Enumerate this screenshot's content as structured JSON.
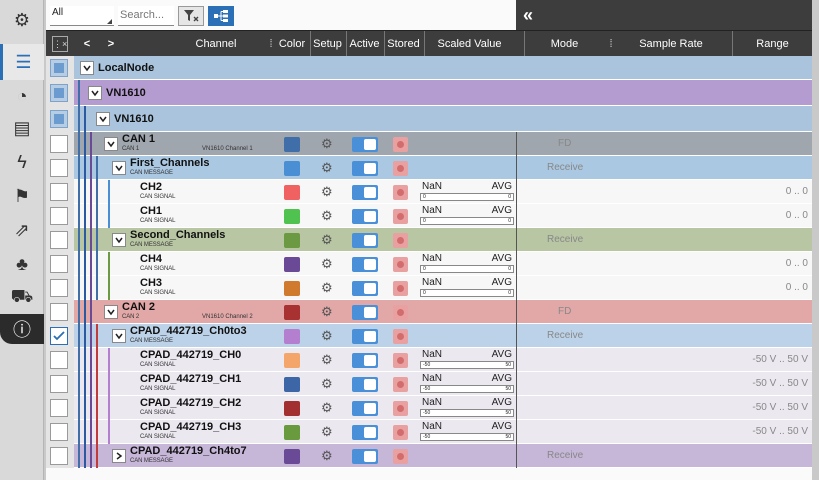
{
  "sidebar": {
    "items": [
      {
        "name": "settings-gear-icon",
        "glyph": "⚙"
      },
      {
        "name": "list-icon",
        "glyph": "☰"
      },
      {
        "name": "gauge-icon",
        "glyph": "◔"
      },
      {
        "name": "report-icon",
        "glyph": "▤"
      },
      {
        "name": "trigger-icon",
        "glyph": "ϟ"
      },
      {
        "name": "flag-icon",
        "glyph": "⚑"
      },
      {
        "name": "export-icon",
        "glyph": "⇗"
      },
      {
        "name": "network-icon",
        "glyph": "♣"
      },
      {
        "name": "vehicle-icon",
        "glyph": "⛟"
      },
      {
        "name": "info-icon",
        "glyph": "ⓘ"
      }
    ]
  },
  "toolbar": {
    "filter_value": "All",
    "search_placeholder": "Search...",
    "collapse_glyph": "«"
  },
  "header": {
    "nav_prev": "<",
    "nav_next": ">",
    "channel": "Channel",
    "color": "Color",
    "setup": "Setup",
    "active": "Active",
    "stored": "Stored",
    "scaled_value": "Scaled Value",
    "mode": "Mode",
    "sample_rate": "Sample Rate",
    "range": "Range"
  },
  "rows": [
    {
      "name": "LocalNode"
    },
    {
      "name": "VN1610"
    },
    {
      "name": "VN1610"
    },
    {
      "name": "CAN 1",
      "sub": "CAN 1",
      "sub2": "VN1610 Channel 1",
      "color": "#3f6ea8",
      "mode": "FD"
    },
    {
      "name": "First_Channels",
      "sub": "CAN MESSAGE",
      "color": "#4a8fd4",
      "mode": "Receive"
    },
    {
      "name": "CH2",
      "sub": "CAN SIGNAL",
      "color": "#f06262",
      "value": "NaN",
      "agg": "AVG",
      "bar_min": "0",
      "bar_max": "0",
      "range": "0 .. 0"
    },
    {
      "name": "CH1",
      "sub": "CAN SIGNAL",
      "color": "#4fc24f",
      "value": "NaN",
      "agg": "AVG",
      "bar_min": "0",
      "bar_max": "0",
      "range": "0 .. 0"
    },
    {
      "name": "Second_Channels",
      "sub": "CAN MESSAGE",
      "color": "#6b9a42",
      "mode": "Receive"
    },
    {
      "name": "CH4",
      "sub": "CAN SIGNAL",
      "color": "#6a4a96",
      "value": "NaN",
      "agg": "AVG",
      "bar_min": "0",
      "bar_max": "0",
      "range": "0 .. 0"
    },
    {
      "name": "CH3",
      "sub": "CAN SIGNAL",
      "color": "#d07a2e",
      "value": "NaN",
      "agg": "AVG",
      "bar_min": "0",
      "bar_max": "0",
      "range": "0 .. 0"
    },
    {
      "name": "CAN 2",
      "sub": "CAN 2",
      "sub2": "VN1610 Channel 2",
      "color": "#a83232",
      "mode": "FD"
    },
    {
      "name": "CPAD_442719_Ch0to3",
      "sub": "CAN MESSAGE",
      "color": "#b57fd0",
      "mode": "Receive"
    },
    {
      "name": "CPAD_442719_CH0",
      "sub": "CAN SIGNAL",
      "color": "#f4a66a",
      "value": "NaN",
      "agg": "AVG",
      "bar_min": "-50",
      "bar_max": "50",
      "range": "-50 V .. 50 V"
    },
    {
      "name": "CPAD_442719_CH1",
      "sub": "CAN SIGNAL",
      "color": "#3d66a6",
      "value": "NaN",
      "agg": "AVG",
      "bar_min": "-50",
      "bar_max": "50",
      "range": "-50 V .. 50 V"
    },
    {
      "name": "CPAD_442719_CH2",
      "sub": "CAN SIGNAL",
      "color": "#a33030",
      "value": "NaN",
      "agg": "AVG",
      "bar_min": "-50",
      "bar_max": "50",
      "range": "-50 V .. 50 V"
    },
    {
      "name": "CPAD_442719_CH3",
      "sub": "CAN SIGNAL",
      "color": "#6a9a3e",
      "value": "NaN",
      "agg": "AVG",
      "bar_min": "-50",
      "bar_max": "50",
      "range": "-50 V .. 50 V"
    },
    {
      "name": "CPAD_442719_Ch4to7",
      "sub": "CAN MESSAGE",
      "color": "#6a4a96",
      "mode": "Receive"
    }
  ]
}
